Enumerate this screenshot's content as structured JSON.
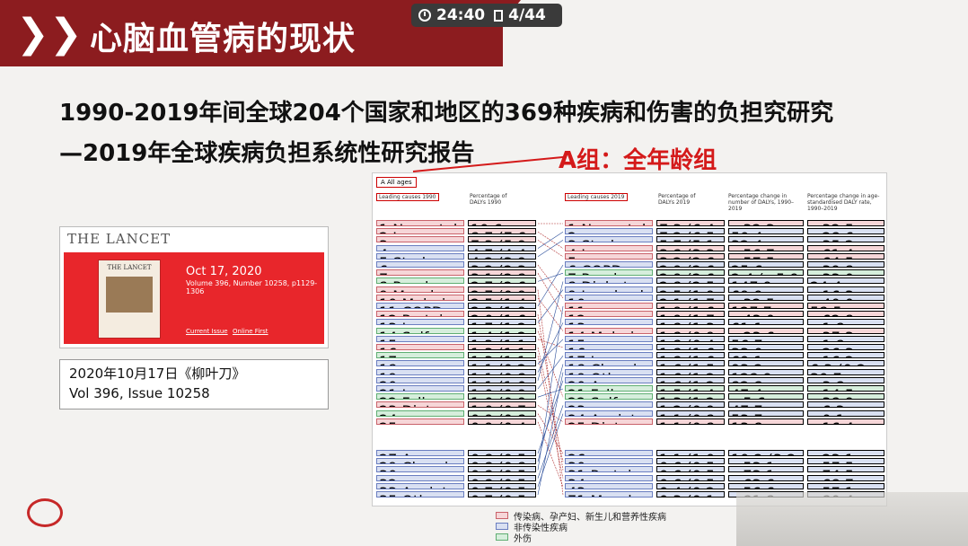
{
  "banner": {
    "title": "心脑血管病的现状",
    "chevrons": "❯❯"
  },
  "status": {
    "time": "24:40",
    "page": "4/44"
  },
  "headline": {
    "line1": "1990-2019年间全球204个国家和地区的369种疾病和伤害的负担究研究",
    "line2": "—2019年全球疾病负担系统性研究报告"
  },
  "group_label": "A组：全年龄组",
  "lancet": {
    "masthead": "THE LANCET",
    "cover_title": "THE LANCET",
    "date": "Oct 17, 2020",
    "volume": "Volume 396, Number 10258, p1129-1306",
    "link1": "Current Issue",
    "link2": "Online First"
  },
  "citation": {
    "line1": "2020年10月17日《柳叶刀》",
    "line2": "Vol 396, Issue 10258"
  },
  "table": {
    "panel": "A  All ages",
    "h_left": "Leading causes 1990",
    "h_pct1990": "Percentage of DALYs 1990",
    "h_right": "Leading causes 2019",
    "h_pct2019": "Percentage of DALYs 2019",
    "h_chg": "Percentage change in number of DALYs, 1990–2019",
    "h_asr": "Percentage change in age-standardised DALY rate, 1990–2019",
    "left": [
      [
        "1 Neonatal disorders",
        "10·6 (9·9 to 11·4)",
        "r"
      ],
      [
        "2 Lower respiratory infections",
        "8·7 (7·6 to 10·0)",
        "r"
      ],
      [
        "3 Diarrhoeal diseases",
        "7·3 (5·9 to 8·8)",
        "r"
      ],
      [
        "4 Ischaemic heart disease",
        "4·7 (4·4 to 5·0)",
        "b"
      ],
      [
        "5 Stroke",
        "4·2 (3·9 to 4·5)",
        "b"
      ],
      [
        "6 Congenital birth defects",
        "3·2 (2·3 to 4·8)",
        "b"
      ],
      [
        "7 Tuberculosis",
        "3·1 (2·8 to 3·4)",
        "r"
      ],
      [
        "8 Road injuries",
        "2·7 (2·6 to 3·0)",
        "g"
      ],
      [
        "9 Measles",
        "2·7 (0·9 to 5·6)",
        "r"
      ],
      [
        "10 Malaria",
        "2·5 (1·4 to 4·1)",
        "r"
      ],
      [
        "11 COPD",
        "2·3 (1·9 to 2·5)",
        "b"
      ],
      [
        "12 Protein-energy malnutrition",
        "2·0 (1·6 to 2·7)",
        "r"
      ],
      [
        "13 Low back pain",
        "1·7 (1·2 to 2·1)",
        "b"
      ],
      [
        "14 Self-harm",
        "1·4 (1·2 to 1·5)",
        "g"
      ],
      [
        "15 Cirrhosis",
        "1·3 (1·1 to 1·5)",
        "b"
      ],
      [
        "16 Meningitis",
        "1·3 (1·1 to 1·5)",
        "r"
      ],
      [
        "17 Drowning",
        "1·3 (1·1 to 1·4)",
        "g"
      ],
      [
        "18 Headache disorders",
        "1·1 (0·2 to 2·4)",
        "b"
      ],
      [
        "19 Depressive disorders",
        "1·1 (0·8 to 1·5)",
        "b"
      ],
      [
        "20 Diabetes",
        "1·1 (1·0 to 1·2)",
        "b"
      ],
      [
        "21 Lung cancer",
        "1·0 (0·9 to 1·1)",
        "b"
      ],
      [
        "22 Falls",
        "1·0 (0·9 to 1·2)",
        "g"
      ],
      [
        "23 Dietary iron deficiency",
        "1·0 (0·7 to 1·3)",
        "r"
      ],
      [
        "24 Interpersonal violence",
        "0·9 (0·8 to 1·0)",
        "g"
      ],
      [
        "25 Whooping cough",
        "0·9 (0·4 to 1·7)",
        "r"
      ]
    ],
    "left_more": [
      [
        "27 Age-related hearing loss",
        "0·8 (0·5 to 1·1)"
      ],
      [
        "29 Chronic kidney disease",
        "0·8 (0·8 to 0·9)"
      ],
      [
        "30 HIV/AIDS",
        "0·8 (0·5 to 1·1)"
      ],
      [
        "32 Gynaecological diseases",
        "0·8 (0·5 to 1·0)"
      ],
      [
        "33 Anxiety disorders",
        "0·7 (0·5 to 1·0)"
      ],
      [
        "35 Other musculoskeletal",
        "0·7 (0·5 to 1·0)"
      ]
    ],
    "right": [
      [
        "1 Neonatal disorders",
        "7·3 (6·4 to 8·4)",
        "−32·3 (−41·7 to −20·8)",
        "−32·5 (−42·1 to −21·2)",
        "r"
      ],
      [
        "2 Ischaemic heart disease",
        "7·2 (6·5 to 7·9)",
        "50·4 (39·9 to 60·2)",
        "−28·6 (−33·3 to −24·2)",
        "b"
      ],
      [
        "3 Stroke",
        "5·7 (5·1 to 6·2)",
        "32·4 (22·0 to 42·2)",
        "−35·2 (−40·5 to −30·5)",
        "b"
      ],
      [
        "4 Lower respiratory infections",
        "3·8 (3·3 to 4·3)",
        "−56·7 (−60·2 to −52·5)",
        "−61·4 (−64·3 to −57·4)",
        "r"
      ],
      [
        "5 Diarrhoeal diseases",
        "3·2 (2·6 to 4·0)",
        "−57·5 (−65·2 to −44·7)",
        "−64·5 (−71·7 to −54·2)",
        "r"
      ],
      [
        "6 COPD",
        "2·9 (2·6 to 3·2)",
        "25·6 (15·1 to 46·0)",
        "−39·8 (−44·9 to −30·2)",
        "b"
      ],
      [
        "7 Road injuries",
        "2·9 (2·6 to 3·0)",
        "2·4 (−5·9 to 10·8)",
        "−33·0 (−37·1 to −25·4)",
        "g"
      ],
      [
        "8 Diabetes",
        "2·8 (2·5 to 3·1)",
        "147·9 (135·9 to 158·9)",
        "24·4 (18·5 to 29·7)",
        "b"
      ],
      [
        "9 Low back pain",
        "2·5 (1·9 to 3·1)",
        "69·9 (43·3 to 90·5)",
        "−16·3 (−17·3 to −15·5)",
        "b"
      ],
      [
        "10 Congenital birth defects",
        "2·1 (1·7 to 2·6)",
        "−32·5 (−51·6 to −13·8)",
        "−40·0 (−57·2 to −17·3)",
        "b"
      ],
      [
        "11 HIV/AIDS",
        "1·9 (1·6 to 2·2)",
        "127·7 (97·3 to 171·7)",
        "58·5 (−37·1 to 89·2)",
        "r"
      ],
      [
        "12 Tuberculosis",
        "1·9 (1·7 to 2·0)",
        "−43·0 (−47·2 to −33·5)",
        "−62·8 (−66·6 to −58·0)",
        "r"
      ],
      [
        "13 Depressive disorders",
        "1·8 (1·3 to 2·4)",
        "61·1 (56·9 to 65·0)",
        "−1·8 (−2·9 to −0·8)",
        "b"
      ],
      [
        "14 Malaria",
        "1·8 (0·9 to 3·1)",
        "−23·6 (−56·9 to 6·0)",
        "−37·3 (−61·0 to −6·2)",
        "r"
      ],
      [
        "15 Headache disorders",
        "1·8 (0·4 to 3·8)",
        "56·7 (52·3 to 60·8)",
        "−1·8 (−2·8 to −0·8)",
        "b"
      ],
      [
        "16 Cirrhosis",
        "1·8 (1·6 to 2·0)",
        "33·0 (22·0 to 48·2)",
        "−26·3 (−32·5 to −19·3)",
        "b"
      ],
      [
        "17 Lung cancer",
        "1·8 (1·6 to 2·0)",
        "69·1 (53·1 to 85·4)",
        "−16·2 (−24·6 to −7·6)",
        "b"
      ],
      [
        "18 Chronic kidney disease",
        "1·6 (1·5 to 1·8)",
        "93·2 (81·0 to 105·0)",
        "6·3 (0·2 to 12·6)",
        "b"
      ],
      [
        "19 Other musculoskeletal",
        "1·6 (1·2 to 2·1)",
        "128·9 (122·0 to 136·1)",
        "30·7 (27·6 to 34·1)",
        "b"
      ],
      [
        "20 Age-related hearing loss",
        "1·6 (1·2 to 2·1)",
        "82·8 (75·2 to 89·9)",
        "−3·8 (−7·4 to −0·1)",
        "b"
      ],
      [
        "21 Falls",
        "1·5 (1·4 to 1·7)",
        "47·4 (31·5 to 61·0)",
        "−14·5 (−22·5 to −7·4)",
        "g"
      ],
      [
        "22 Self-harm",
        "1·3 (1·2 to 1·4)",
        "−5·6 (−14·2 to 3·7)",
        "−38·9 (−44·0 to −33·0)",
        "g"
      ],
      [
        "23 Gynaecological diseases",
        "1·2 (0·9 to 1·5)",
        "47·7 (45·0 to 51·5)",
        "−6·3 (−8·7 to −4·9)",
        "b"
      ],
      [
        "24 Anxiety disorders",
        "1·1 (0·8 to 1·6)",
        "53·7 (48·0 to 57·3)",
        "−0·1 (−1·5 to 0·7)",
        "b"
      ],
      [
        "25 Dietary iron deficiency",
        "1·1 (0·8 to 1·5)",
        "13·8 (10·0 to 17·2)",
        "−16·4 (−18·7 to −14·0)",
        "r"
      ]
    ],
    "right_more": [
      [
        "26 Interpersonal violence",
        "1·1 (1·0 to 1·2)",
        "10·2 (3·2 to 15·2)",
        "−23·1 (−28·6 to −17·8)"
      ],
      [
        "30 Meningitis",
        "0·6 (0·5 to 0·7)",
        "−53·1 (−59·6 to −42·8)",
        "−57·5 (−64·4 to −48·6)"
      ],
      [
        "31 Protein-energy malnutrition",
        "0·6 (0·5 to 0·7)",
        "−73·1 (−79·6 to −59·7)",
        "−74·5 (−82·0 to −64·5)"
      ],
      [
        "34 Drowning",
        "0·6 (0·5 to 0·6)",
        "−63·6 (−66·2 to −53·8)",
        "−68·7 (−71·9 to −62·8)"
      ],
      [
        "43 Whooping cough",
        "0·4 (0·2 to 0·7)",
        "−56·6 (−74·6 to −16·9)",
        "−57·1 (−75·3 to −14·1)"
      ],
      [
        "71 Measles",
        "0·3 (0·1 to 0·6)",
        "−81·8 (−92·3 to −86·3)",
        "−80·4 (−92·8 to −87·5)"
      ]
    ]
  },
  "legend": [
    {
      "label": "传染病、孕产妇、新生儿和营养性疾病",
      "color": "#f6d6d8",
      "border": "#c9626a"
    },
    {
      "label": "非传染性疾病",
      "color": "#d9e0f2",
      "border": "#6a7ec0"
    },
    {
      "label": "外伤",
      "color": "#d6eedc",
      "border": "#5fae72"
    }
  ],
  "colors": {
    "banner": "#8c1c1f",
    "accent_red": "#d41a1a",
    "lancet_red": "#e8262b"
  }
}
